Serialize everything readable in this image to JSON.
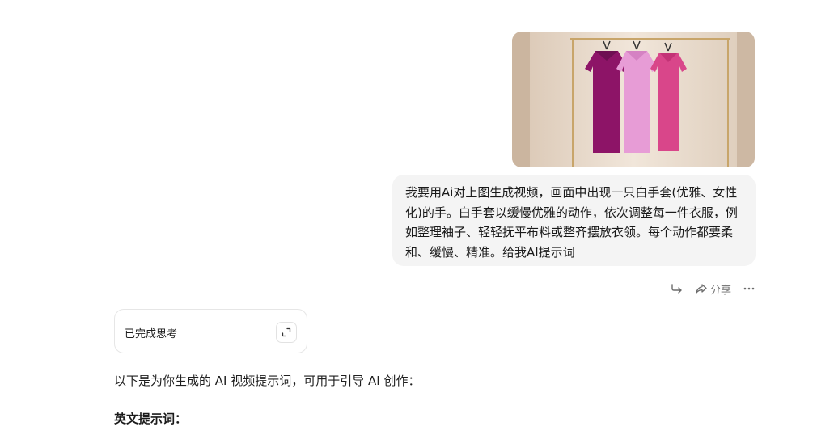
{
  "conversation": {
    "user_message": {
      "image_icon": "clothing-rack-photo",
      "text": "我要用Ai对上图生成视频，画面中出现一只白手套(优雅、女性化)的手。白手套以缓慢优雅的动作，依次调整每一件衣服，例如整理袖子、轻轻抚平布料或整齐摆放衣领。每个动作都要柔和、缓慢、精准。给我AI提示词",
      "actions": {
        "reply_icon": "reply-arrow-icon",
        "share_icon": "share-icon",
        "share_label": "分享",
        "more_icon": "more-dots-icon"
      }
    },
    "assistant_message": {
      "thinking_label": "已完成思考",
      "expand_icon": "expand-icon",
      "intro": "以下是为你生成的 AI 视频提示词，可用于引导 AI 创作：",
      "section_heading": "英文提示词："
    }
  },
  "colors": {
    "bubble_bg": "#f4f4f4",
    "icon_gray": "#6b6b6b",
    "card_border": "#e6e6e6"
  }
}
